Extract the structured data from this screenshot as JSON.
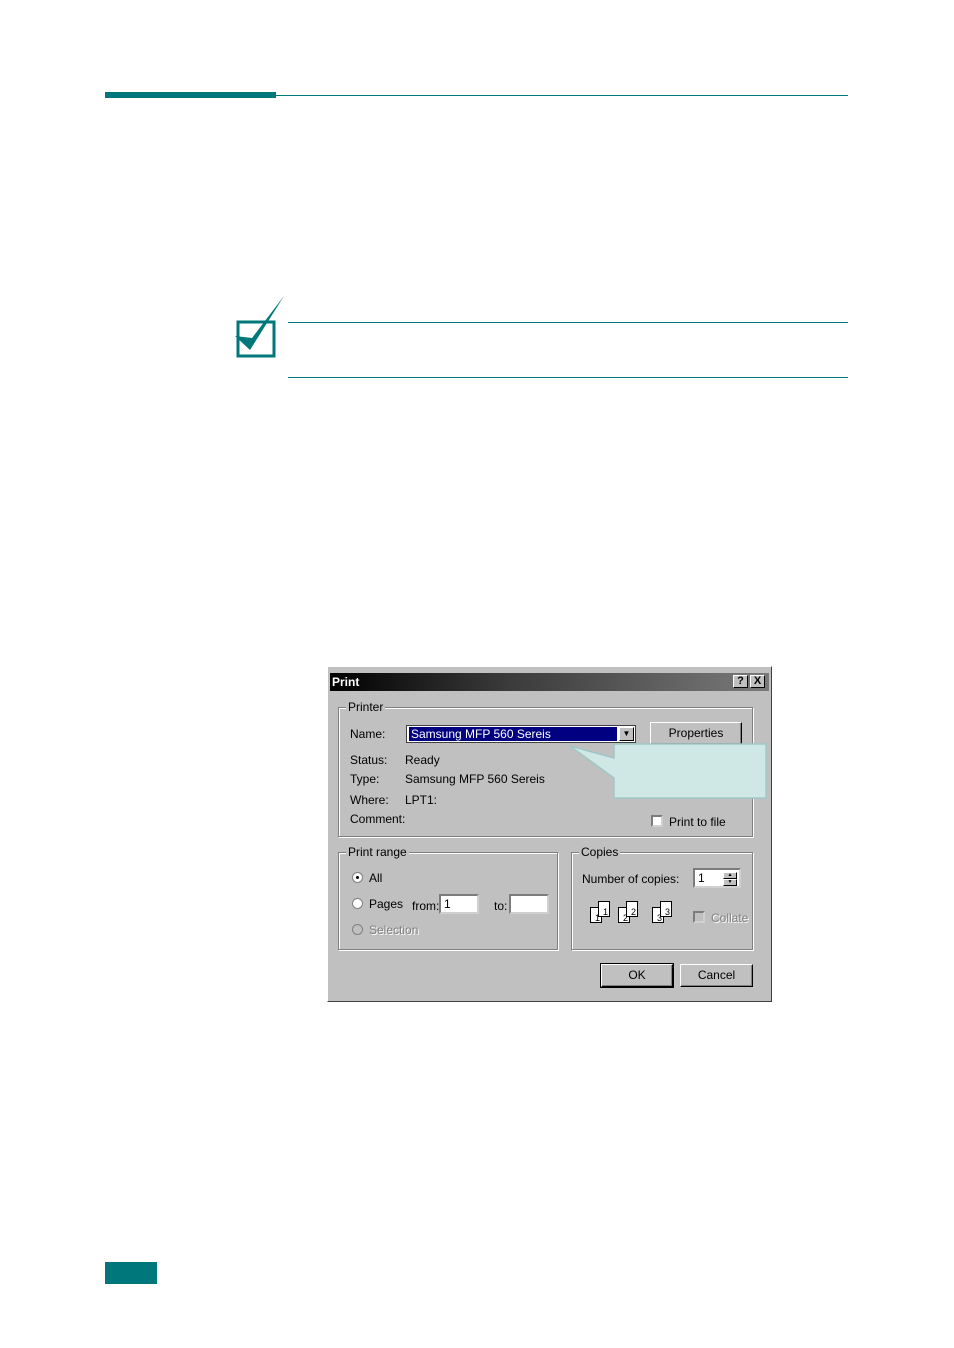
{
  "dialog": {
    "title": "Print",
    "help_button": "?",
    "close_button": "X",
    "printer_group": "Printer",
    "name_label": "Name:",
    "name_value": "Samsung MFP 560 Sereis",
    "properties_button": "Properties",
    "status_label": "Status:",
    "status_value": "Ready",
    "type_label": "Type:",
    "type_value": "Samsung MFP 560 Sereis",
    "where_label": "Where:",
    "where_value": "LPT1:",
    "comment_label": "Comment:",
    "print_to_file": "Print to file",
    "print_range_group": "Print range",
    "range_all": "All",
    "range_pages": "Pages",
    "from_label": "from:",
    "from_value": "1",
    "to_label": "to:",
    "to_value": "",
    "range_selection": "Selection",
    "copies_group": "Copies",
    "copies_label": "Number of copies:",
    "copies_value": "1",
    "collate_label": "Collate",
    "page_icons": [
      "1",
      "1",
      "2",
      "2",
      "3",
      "3"
    ],
    "ok_button": "OK",
    "cancel_button": "Cancel"
  },
  "colors": {
    "accent": "#00777a",
    "callout_fill": "#cfe8e6"
  }
}
